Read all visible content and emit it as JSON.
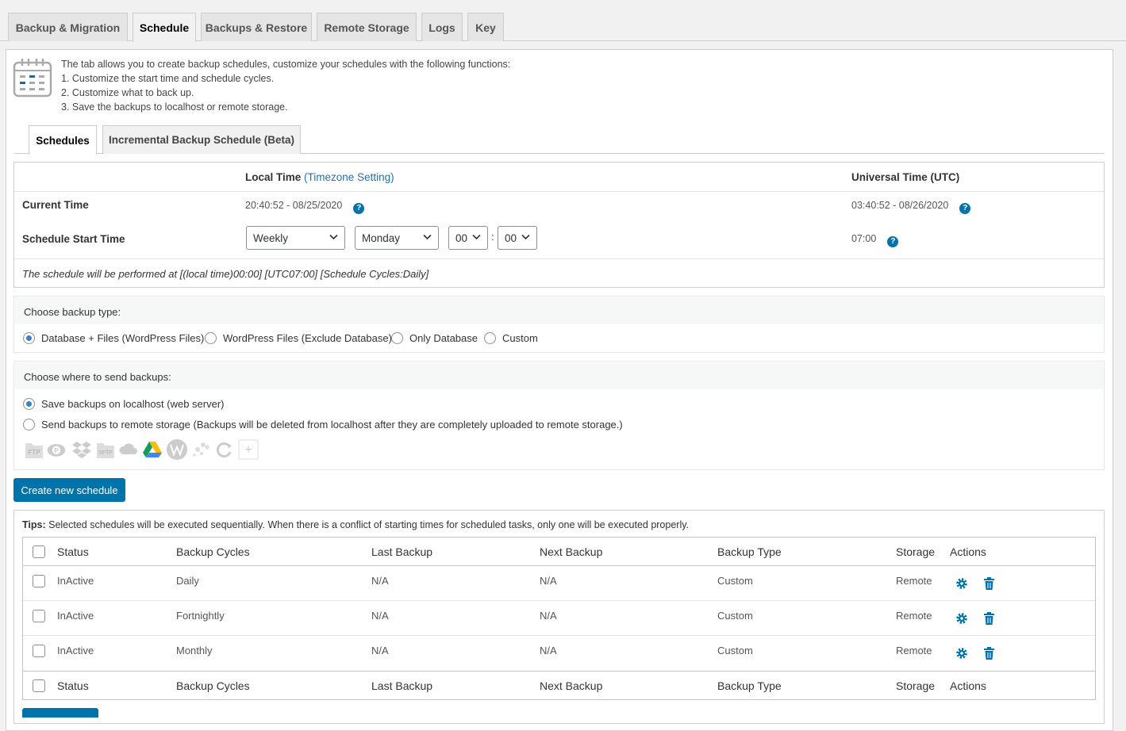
{
  "nav_tabs": [
    {
      "label": "Backup & Migration",
      "active": false
    },
    {
      "label": "Schedule",
      "active": true
    },
    {
      "label": "Backups & Restore",
      "active": false
    },
    {
      "label": "Remote Storage",
      "active": false
    },
    {
      "label": "Logs",
      "active": false
    },
    {
      "label": "Key",
      "active": false
    }
  ],
  "intro": {
    "icon": "calendar-icon",
    "lines": [
      "The tab allows you to create backup schedules, customize your schedules with the following functions:",
      "1. Customize the start time and schedule cycles.",
      "2. Customize what to back up.",
      "3. Save the backups to localhost or remote storage."
    ]
  },
  "sub_tabs": [
    {
      "label": "Schedules",
      "active": true
    },
    {
      "label": "Incremental Backup Schedule (Beta)",
      "active": false
    }
  ],
  "time_box": {
    "local_time_label": "Local Time",
    "timezone_link": "(Timezone Setting)",
    "utc_label": "Universal Time (UTC)",
    "current_time_label": "Current Time",
    "current_local": "20:40:52 - 08/25/2020",
    "current_utc": "03:40:52 - 08/26/2020",
    "start_time_label": "Schedule Start Time",
    "cycle_select": "Weekly",
    "day_select": "Monday",
    "hour_select": "00",
    "time_separator": ":",
    "minute_select": "00",
    "start_utc": "07:00",
    "help_glyph": "?",
    "summary": "The schedule will be performed at [(local time)00:00] [UTC07:00] [Schedule Cycles:Daily]"
  },
  "backup_type": {
    "heading": "Choose backup type:",
    "options": [
      {
        "label": "Database + Files (WordPress Files)",
        "checked": true
      },
      {
        "label": "WordPress Files (Exclude Database)",
        "checked": false
      },
      {
        "label": "Only Database",
        "checked": false
      },
      {
        "label": "Custom",
        "checked": false
      }
    ]
  },
  "destination": {
    "heading": "Choose where to send backups:",
    "options": [
      {
        "label": "Save backups on localhost (web server)",
        "checked": true
      },
      {
        "label": "Send backups to remote storage (Backups will be deleted from localhost after they are completely uploaded to remote storage.)",
        "checked": false
      }
    ],
    "storage_icons": [
      {
        "icon": "ftp-icon",
        "text": "FTP"
      },
      {
        "icon": "pcloud-icon",
        "text": ""
      },
      {
        "icon": "dropbox-icon",
        "text": ""
      },
      {
        "icon": "sftp-icon",
        "text": "SFTP"
      },
      {
        "icon": "onedrive-icon",
        "text": ""
      },
      {
        "icon": "google-drive-icon",
        "text": ""
      },
      {
        "icon": "wasabi-icon",
        "text": ""
      },
      {
        "icon": "digitalocean-icon",
        "text": ""
      },
      {
        "icon": "backblaze-icon",
        "text": ""
      },
      {
        "icon": "add-storage-icon",
        "text": "+"
      }
    ]
  },
  "create_button": "Create new schedule",
  "tips": {
    "label": "Tips:",
    "text": " Selected schedules will be executed sequentially. When there is a conflict of starting times for scheduled tasks, only one will be executed properly."
  },
  "table": {
    "columns": [
      "Status",
      "Backup Cycles",
      "Last Backup",
      "Next Backup",
      "Backup Type",
      "Storage",
      "Actions"
    ],
    "rows": [
      {
        "status": "InActive",
        "cycle": "Daily",
        "last": "N/A",
        "next": "N/A",
        "type": "Custom",
        "storage": "Remote"
      },
      {
        "status": "InActive",
        "cycle": "Fortnightly",
        "last": "N/A",
        "next": "N/A",
        "type": "Custom",
        "storage": "Remote"
      },
      {
        "status": "InActive",
        "cycle": "Monthly",
        "last": "N/A",
        "next": "N/A",
        "type": "Custom",
        "storage": "Remote"
      }
    ]
  },
  "colors": {
    "accent": "#0073aa",
    "border": "#ccd0d4"
  }
}
